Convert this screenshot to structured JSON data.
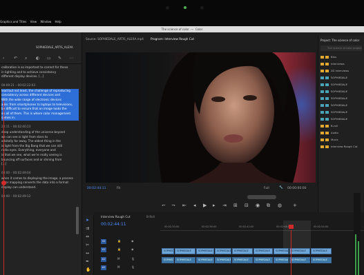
{
  "window": {
    "title": "The science of color",
    "subtitle": "Color"
  },
  "menu": [
    "Graphics and Titles",
    "View",
    "Window",
    "Help"
  ],
  "source_monitor": {
    "tab_source": "Source: SOPHIEDALE_ARTIS_ALEXA.mp4",
    "tab_program": "Program: Interview Rough Cut"
  },
  "transcript": {
    "panel_label": "SOPHIEDALE_ARTIS_ALEXA",
    "blocks": [
      {
        "time": "",
        "lines": [
          "calibration is so important to correct for these",
          "in lighting and to achieve consistency",
          "different display devices. [...]"
        ],
        "highlight": false
      },
      {
        "time": "00:09:21 – 00:02:22:03",
        "lines": [
          "lead but not least, the challenge of reproducing",
          "consistency across different devices and",
          "With the wide range of electronic devices",
          "able: from smartphones to laptops to televisions,",
          "be difficult to ensure that an image looks the",
          "on all of them. This is where color management",
          "comes in."
        ],
        "highlight": true
      },
      {
        "time": "22:11 – 00:02:40:23",
        "lines": [
          "deep understanding of the universe beyond",
          "we can see is light from stars to",
          "orbitally far away. The oldest thing in the",
          "is light from the Big Bang that we can still",
          "radio eyes. Everything, everyone and",
          "is that we see, what we're really seeing is",
          "bouncing off surfaces and or shining from",
          "[...]"
        ],
        "highlight": false
      },
      {
        "time": "00:00 – 00:02:49:04",
        "lines": [
          "when it comes to displaying the image, a process",
          "color mapping converts the data into a format",
          "display can understand."
        ],
        "highlight": false
      },
      {
        "time": "00:00 – 00:02:49:12",
        "lines": [],
        "highlight": false
      }
    ]
  },
  "program_monitor": {
    "timecode": "00:02:44:11",
    "fit": "Fit",
    "quality": "Full",
    "duration": "00:00:00:00"
  },
  "project": {
    "title": "Project: The science of color",
    "search_placeholder": "The science of color project",
    "items": [
      {
        "type": "folder",
        "name": "Bins",
        "color": "#e0a830"
      },
      {
        "type": "folder",
        "name": "Interviews",
        "color": "#e0a830"
      },
      {
        "type": "folder",
        "name": "2D Interviews",
        "color": "#e0a830"
      },
      {
        "type": "clip",
        "name": "SOPHIEDALE",
        "color": "#4aa3b8"
      },
      {
        "type": "clip",
        "name": "SOPHIEDALE",
        "color": "#4aa3b8"
      },
      {
        "type": "clip",
        "name": "SOPHIEDALE",
        "color": "#4aa3b8"
      },
      {
        "type": "clip",
        "name": "SOPHIEDALE",
        "color": "#4aa3b8"
      },
      {
        "type": "clip",
        "name": "SOPHIEDALE",
        "color": "#4aa3b8"
      },
      {
        "type": "clip",
        "name": "SOPHIEDALE",
        "color": "#4aa3b8"
      },
      {
        "type": "clip",
        "name": "SOPHIEDALE",
        "color": "#4aa3b8"
      },
      {
        "type": "folder",
        "name": "B-roll",
        "color": "#e0a830"
      },
      {
        "type": "folder",
        "name": "Audio",
        "color": "#e0a830"
      },
      {
        "type": "folder",
        "name": "Music",
        "color": "#e0a830"
      },
      {
        "type": "folder",
        "name": "Interview Rough Cut",
        "color": "#e0a830"
      }
    ]
  },
  "timeline": {
    "tab": "Interview Rough Cut",
    "tab2": "B-Roll",
    "timecode": "00:02:44:11",
    "ruler": [
      "00:02:30:00",
      "00:02:36:00",
      "00:02:42:00",
      "00:02:48:00",
      "00:02:54:00"
    ],
    "tracks": [
      {
        "label": "V2"
      },
      {
        "label": "V1"
      },
      {
        "label": "A1"
      },
      {
        "label": "A2"
      }
    ],
    "clip_label": "SOPHIEDALE"
  }
}
